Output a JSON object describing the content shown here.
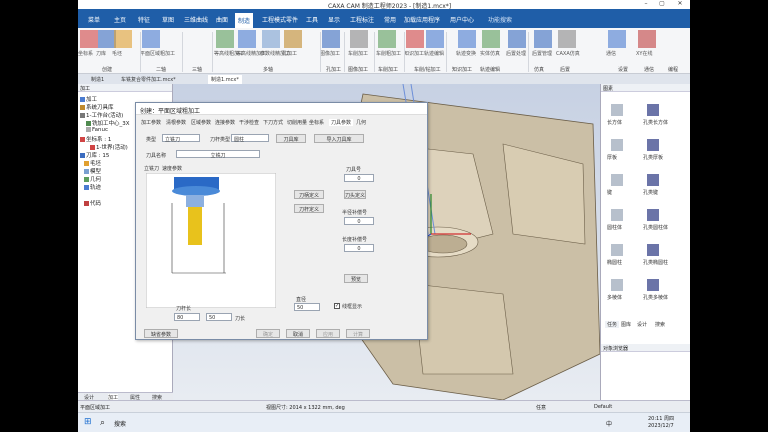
{
  "window": {
    "title": "CAXA CAM 制造工程师2023 - [制造1.mcx*]"
  },
  "menu": {
    "tabs": [
      "菜单",
      "主页",
      "特征",
      "草图",
      "三维曲线",
      "曲面",
      "制造",
      "工程模式零件",
      "工具",
      "显示",
      "工程标注",
      "常用",
      "加载应用程序",
      "用户中心"
    ],
    "active": "制造",
    "search_placeholder": "功能搜索"
  },
  "ribbon": {
    "buttons": [
      "坐标系",
      "刀库",
      "毛坯",
      "平面区域粗加工",
      "等高线粗加工",
      "等高线精加工",
      "参数线精加工",
      "孔加工",
      "图像加工",
      "车削加工",
      "车削粗加工",
      "知识加工",
      "轨迹编辑",
      "轨迹变换",
      "实体仿真",
      "后置处理",
      "后置管理",
      "CAXA仿真",
      "通信",
      "XY在线"
    ],
    "groups": [
      "创建",
      "二轴",
      "三轴",
      "多轴",
      "孔加工",
      "图像加工",
      "车削加工",
      "车削/钻加工",
      "知识加工",
      "轨迹变换",
      "轨迹编辑",
      "仿真",
      "后置",
      "设置",
      "通信",
      "编程"
    ]
  },
  "doc_tabs": [
    "制造1",
    "车铣复合零件加工.mcx*",
    "制造1.mcx*"
  ],
  "tree": {
    "header": "加工",
    "items": [
      "加工",
      "系统刀具库",
      "1-工作台(活动)",
      "铣加工中心_3X",
      "Fanuc",
      "坐标系 : 1",
      "1-世界(活动)",
      "刀库 : 15",
      "毛坯",
      "模型",
      "几何",
      "轨迹",
      "代码"
    ]
  },
  "left_tabs": [
    "设计",
    "加工",
    "属性",
    "搜索"
  ],
  "dialog": {
    "title": "创建：平面区域粗加工",
    "tabs": [
      "加工参数",
      "清根参数",
      "区域参数",
      "连接参数",
      "干涉检查",
      "下刀方式",
      "切削用量",
      "坐标系",
      "刀具参数",
      "几何"
    ],
    "type_label": "类型",
    "type_value": "立铣刀",
    "stock_label": "刀杆类型",
    "stock_value": "圆柱",
    "btn_tool_lib": "刀具库",
    "btn_save_lib": "导入刀具库",
    "name_label": "刀具名称",
    "name_value": "立铣刀",
    "sub_tabs": [
      "立铣刀",
      "速度参数"
    ],
    "tool_no_label": "刀具号",
    "tool_no_value": "0",
    "btn_edit": "刀柄定义",
    "btn_cut_def": "刀头定义",
    "btn_c3": "刀杆定义",
    "comp_label": "半径补偿号",
    "comp_value": "0",
    "len_comp_label": "长度补偿号",
    "len_comp_value": "0",
    "btn_preview": "预览",
    "dia_label": "刀杆长",
    "dia_value": "80",
    "dia2_value": "50",
    "unit_label": "刀长",
    "hang_label": "直径",
    "hang_value": "50",
    "checkbox_label": "线框显示",
    "btn_default": "缺省参数",
    "btn_ok": "确定",
    "btn_cancel": "取消",
    "btn_apply": "应用",
    "btn_suspend": "计算"
  },
  "right_panel": {
    "header": "图素",
    "items": [
      "长方体",
      "孔类长方体",
      "厚板",
      "孔类厚板",
      "键",
      "孔类键",
      "圆柱体",
      "孔类圆柱体",
      "椭圆柱",
      "孔类椭圆柱",
      "多棱体",
      "孔类多棱体"
    ],
    "footer_tabs": [
      "任务",
      "图库",
      "设计"
    ],
    "search": "搜索"
  },
  "obj_browser": {
    "header": "对象浏览器"
  },
  "status": {
    "left": "平面区域加工",
    "center": "视图尺寸: 2014 x 1322  mm, deg",
    "right": "任意",
    "default": "Default"
  },
  "taskbar": {
    "search": "搜索",
    "time": "20:11 周四",
    "date": "2023/12/7",
    "lang": "中"
  }
}
